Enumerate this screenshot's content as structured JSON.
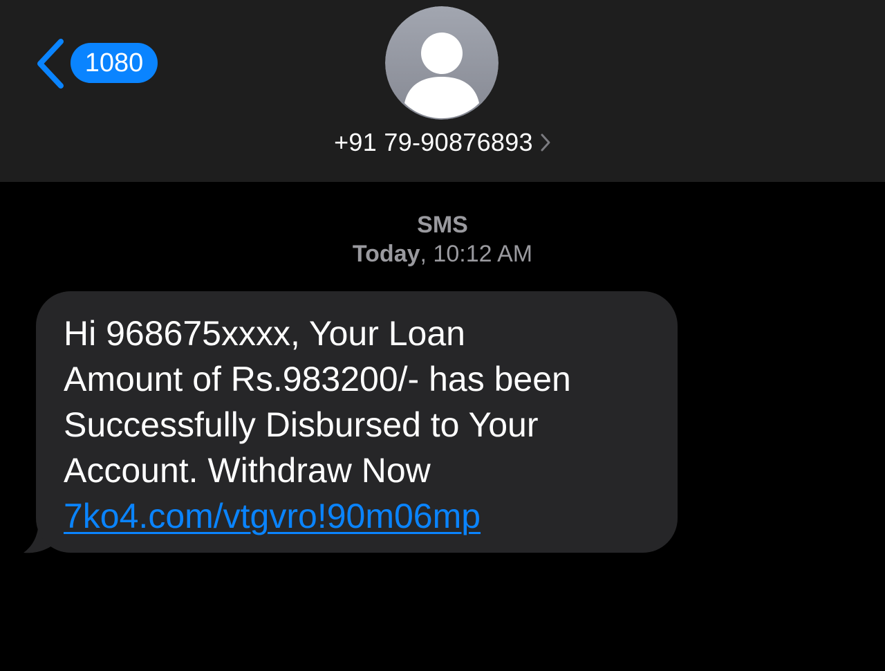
{
  "nav": {
    "back_icon": "chevron-left-icon",
    "unread_count": "1080"
  },
  "contact": {
    "avatar_icon": "person-silhouette-icon",
    "number": "+91 79-90876893",
    "detail_icon": "chevron-right-icon"
  },
  "conversation": {
    "service": "SMS",
    "day": "Today",
    "time": ", 10:12 AM"
  },
  "message": {
    "direction": "incoming",
    "text": "Hi 968675xxxx, Your Loan\nAmount of Rs.983200/- has been\nSuccessfully Disbursed to Your\nAccount. Withdraw Now",
    "link": "7ko4.com/vtgvro!90m06mp"
  },
  "colors": {
    "header_bg": "#1e1e1e",
    "accent": "#0a84ff",
    "bubble_bg": "#262628",
    "meta_text": "#9a9a9f"
  }
}
